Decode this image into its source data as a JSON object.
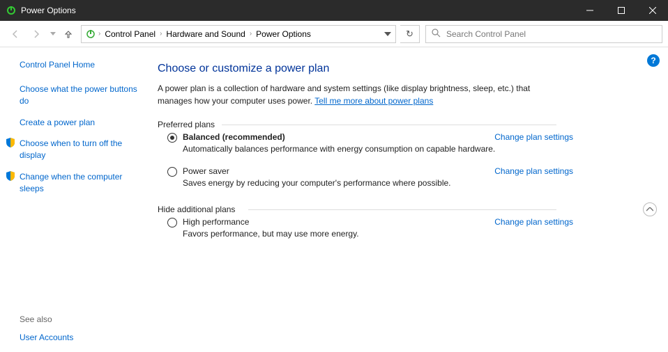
{
  "window": {
    "title": "Power Options"
  },
  "breadcrumb": [
    "Control Panel",
    "Hardware and Sound",
    "Power Options"
  ],
  "search": {
    "placeholder": "Search Control Panel"
  },
  "sidebar": {
    "home": "Control Panel Home",
    "links": [
      {
        "label": "Choose what the power buttons do",
        "shield": false
      },
      {
        "label": "Create a power plan",
        "shield": false
      },
      {
        "label": "Choose when to turn off the display",
        "shield": true
      },
      {
        "label": "Change when the computer sleeps",
        "shield": true
      }
    ],
    "see_also_header": "See also",
    "see_also": [
      "User Accounts"
    ]
  },
  "main": {
    "title": "Choose or customize a power plan",
    "description_pre": "A power plan is a collection of hardware and system settings (like display brightness, sleep, etc.) that manages how your computer uses power. ",
    "description_link": "Tell me more about power plans",
    "preferred_header": "Preferred plans",
    "additional_header": "Hide additional plans",
    "change_link": "Change plan settings",
    "plans_preferred": [
      {
        "name": "Balanced (recommended)",
        "desc": "Automatically balances performance with energy consumption on capable hardware.",
        "selected": true
      },
      {
        "name": "Power saver",
        "desc": "Saves energy by reducing your computer's performance where possible.",
        "selected": false
      }
    ],
    "plans_additional": [
      {
        "name": "High performance",
        "desc": "Favors performance, but may use more energy.",
        "selected": false
      }
    ]
  }
}
